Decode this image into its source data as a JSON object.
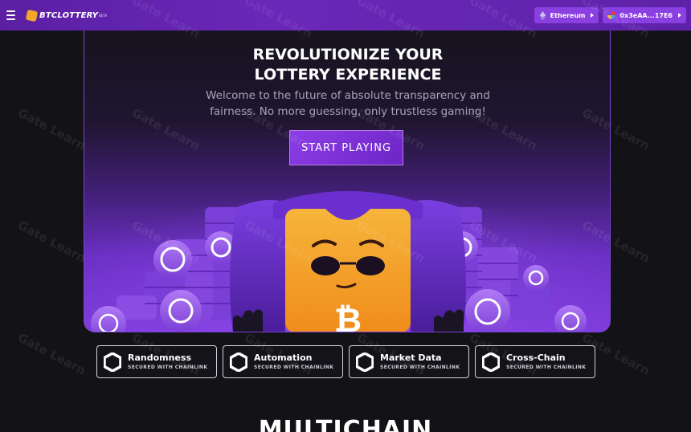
{
  "header": {
    "logo_text": "BTCLOTTERY",
    "logo_sup": "BETA",
    "network": "Ethereum",
    "wallet": "0x3eAA...17E6"
  },
  "hero": {
    "title_line1": "REVOLUTIONIZE YOUR",
    "title_line2": "LOTTERY EXPERIENCE",
    "subtitle_line1": "Welcome to the future of absolute transparency and",
    "subtitle_line2": "fairness. No more guessing, only trustless gaming!",
    "cta_label": "START PLAYING"
  },
  "features": [
    {
      "title": "Randomness",
      "subtitle": "SECURED WITH CHAINLINK"
    },
    {
      "title": "Automation",
      "subtitle": "SECURED WITH CHAINLINK"
    },
    {
      "title": "Market Data",
      "subtitle": "SECURED WITH CHAINLINK"
    },
    {
      "title": "Cross-Chain",
      "subtitle": "SECURED WITH CHAINLINK"
    }
  ],
  "next_section_title": "MULTICHAIN",
  "watermark_text": "Gate Learn",
  "colors": {
    "brand_purple": "#6a28b8",
    "accent_orange": "#f4a62a",
    "background": "#131217"
  },
  "icons": [
    "menu-icon",
    "btc-lottery-logo-icon",
    "ethereum-icon",
    "wallet-avatar-icon",
    "chainlink-hexagon-icon",
    "bitcoin-icon",
    "polygon-coin-icon"
  ]
}
